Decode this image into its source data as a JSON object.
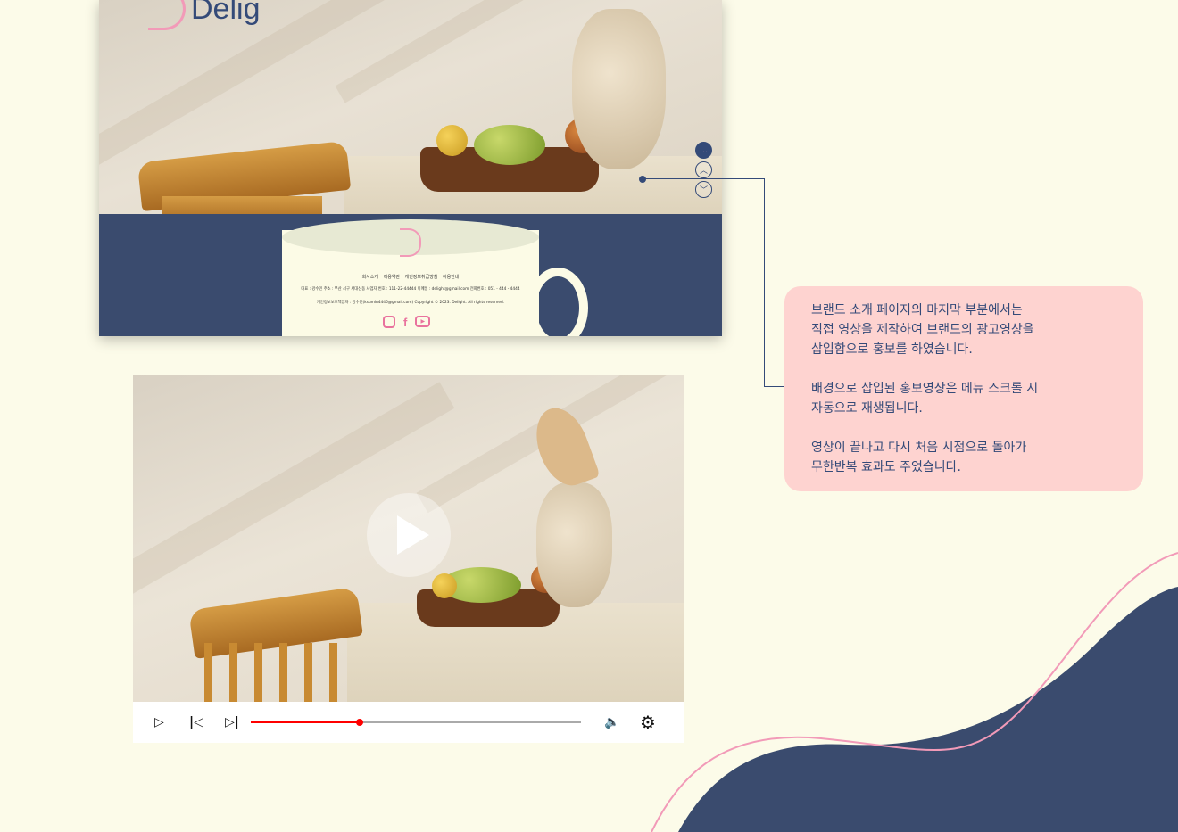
{
  "logo": {
    "text": "Delig"
  },
  "footer": {
    "nav": [
      "회사소개",
      "이용약관",
      "개인정보취급방침",
      "이용안내"
    ],
    "info_line": "대표 : 강수민 주소 : 부산 서구 서대신동 사업자 번호 : 111-22-44444 이메일 : delight@gmail.com 전화번호 : 051 - 444 - 4444",
    "copyright_line": "개인정보보호책임자 : 강수민(ksumin4446@gmail.com) Copyright © 2023. Delight. All rights reserved.",
    "social": [
      "instagram-icon",
      "facebook-icon",
      "youtube-icon"
    ]
  },
  "side_buttons": [
    "chat-icon",
    "scroll-up-icon",
    "scroll-down-icon"
  ],
  "note": {
    "paragraphs": [
      "브랜드 소개 페이지의 마지막 부분에서는\n직접 영상을 제작하여 브랜드의 광고영상을\n삽입함으로 홍보를 하였습니다.",
      "배경으로 삽입된 홍보영상은 메뉴 스크롤 시\n자동으로 재생됩니다.",
      "영상이 끝나고 다시 처음 시점으로 돌아가\n무한반복 효과도 주었습니다."
    ]
  },
  "video": {
    "progress": 0.33
  },
  "colors": {
    "navy": "#3a4b6e",
    "pink": "#f29ab8",
    "note_bg": "#fed3d0",
    "bg": "#fcfbe9"
  }
}
